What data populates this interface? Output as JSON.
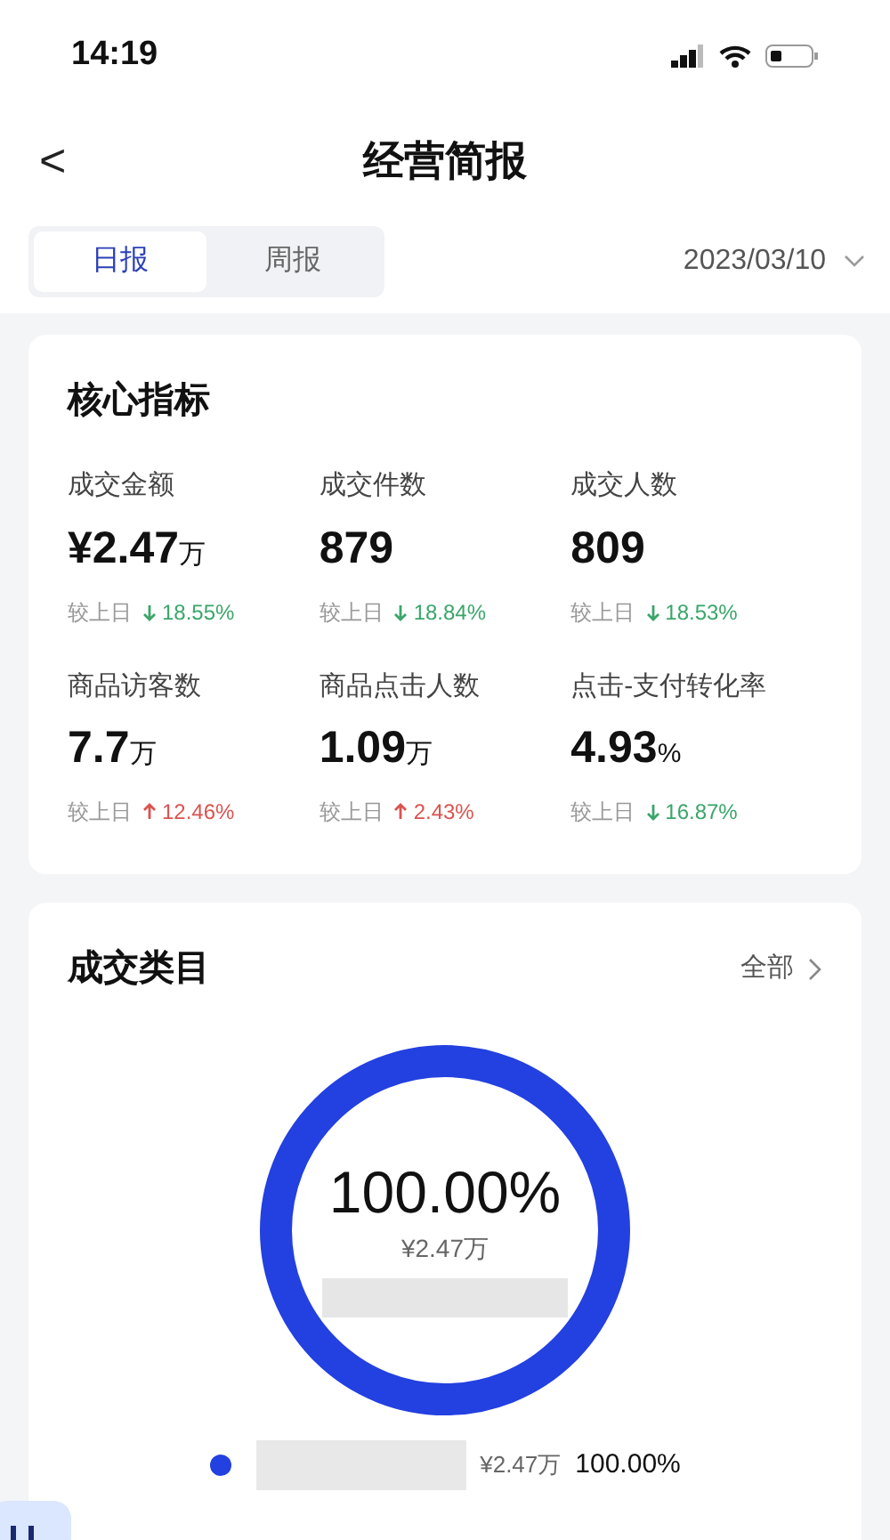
{
  "status_bar": {
    "time": "14:19"
  },
  "header": {
    "back": "<",
    "title": "经营简报"
  },
  "tabs": [
    {
      "label": "日报",
      "selected": true
    },
    {
      "label": "周报",
      "selected": false
    }
  ],
  "date": "2023/03/10",
  "core": {
    "title": "核心指标",
    "metrics": [
      {
        "label": "成交金额",
        "value": "¥2.47",
        "unit": "万",
        "compare": "较上日",
        "change": "18.55%",
        "kind": "down"
      },
      {
        "label": "成交件数",
        "value": "879",
        "compare": "较上日",
        "change": "18.84%",
        "kind": "down"
      },
      {
        "label": "成交人数",
        "value": "809",
        "compare": "较上日",
        "change": "18.53%",
        "kind": "down"
      },
      {
        "label": "商品访客数",
        "value": "7.7",
        "unit": "万",
        "compare": "较上日",
        "change": "12.46%",
        "kind": "up"
      },
      {
        "label": "商品点击人数",
        "value": "1.09",
        "unit": "万",
        "compare": "较上日",
        "change": "2.43%",
        "kind": "up"
      },
      {
        "label": "点击-支付转化率",
        "value": "4.93",
        "unit": "%",
        "compare": "较上日",
        "change": "16.87%",
        "kind": "down"
      }
    ]
  },
  "category": {
    "title": "成交类目",
    "link": "全部",
    "center_percent": "100.00%",
    "center_amount": "¥2.47万",
    "legend": [
      {
        "color": "#2340e0",
        "amount": "¥2.47万",
        "share": "100.00%"
      }
    ]
  }
}
